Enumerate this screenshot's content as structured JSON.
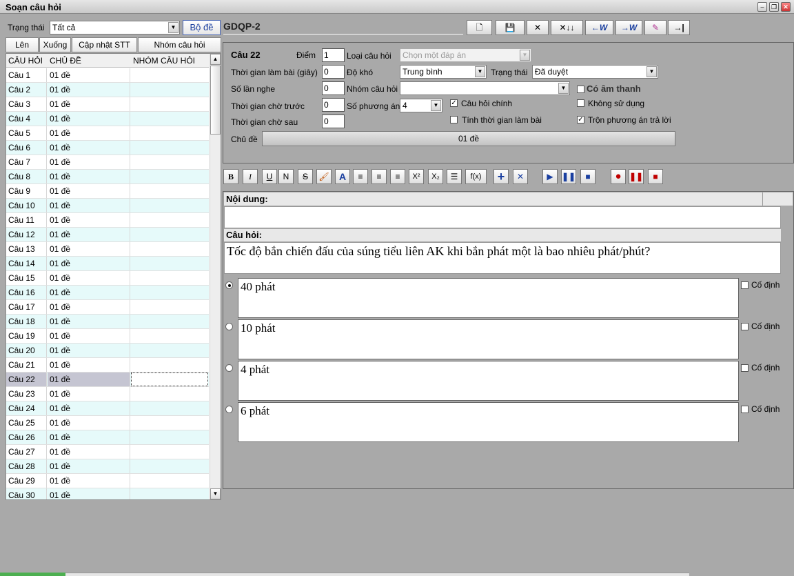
{
  "window": {
    "title": "Soạn câu hỏi"
  },
  "left": {
    "status_label": "Trạng thái",
    "status_value": "Tất cả",
    "set_button": "Bộ đề",
    "btn_up": "Lên",
    "btn_down": "Xuống",
    "btn_update": "Cập nhật STT",
    "btn_group": "Nhóm câu hỏi",
    "columns": [
      "CÂU HỎI",
      "CHỦ ĐỀ",
      "NHÓM CÂU HỎI"
    ],
    "rows": [
      {
        "q": "Câu 1",
        "topic": "01 đề"
      },
      {
        "q": "Câu 2",
        "topic": "01 đề"
      },
      {
        "q": "Câu 3",
        "topic": "01 đề"
      },
      {
        "q": "Câu 4",
        "topic": "01 đề"
      },
      {
        "q": "Câu 5",
        "topic": "01 đề"
      },
      {
        "q": "Câu 6",
        "topic": "01 đề"
      },
      {
        "q": "Câu 7",
        "topic": "01 đề"
      },
      {
        "q": "Câu 8",
        "topic": "01 đề"
      },
      {
        "q": "Câu 9",
        "topic": "01 đề"
      },
      {
        "q": "Câu 10",
        "topic": "01 đề"
      },
      {
        "q": "Câu 11",
        "topic": "01 đề"
      },
      {
        "q": "Câu 12",
        "topic": "01 đề"
      },
      {
        "q": "Câu 13",
        "topic": "01 đề"
      },
      {
        "q": "Câu 14",
        "topic": "01 đề"
      },
      {
        "q": "Câu 15",
        "topic": "01 đề"
      },
      {
        "q": "Câu 16",
        "topic": "01 đề"
      },
      {
        "q": "Câu 17",
        "topic": "01 đề"
      },
      {
        "q": "Câu 18",
        "topic": "01 đề"
      },
      {
        "q": "Câu 19",
        "topic": "01 đề"
      },
      {
        "q": "Câu 20",
        "topic": "01 đề"
      },
      {
        "q": "Câu 21",
        "topic": "01 đề"
      },
      {
        "q": "Câu 22",
        "topic": "01 đề"
      },
      {
        "q": "Câu 23",
        "topic": "01 đề"
      },
      {
        "q": "Câu 24",
        "topic": "01 đề"
      },
      {
        "q": "Câu 25",
        "topic": "01 đề"
      },
      {
        "q": "Câu 26",
        "topic": "01 đề"
      },
      {
        "q": "Câu 27",
        "topic": "01 đề"
      },
      {
        "q": "Câu 28",
        "topic": "01 đề"
      },
      {
        "q": "Câu 29",
        "topic": "01 đề"
      },
      {
        "q": "Câu 30",
        "topic": "01 đề"
      }
    ],
    "selected_row": 21
  },
  "header": {
    "code": "GDQP-2"
  },
  "props": {
    "question": "Câu 22",
    "score_label": "Điểm",
    "score": "1",
    "type_label": "Loại câu hỏi",
    "type_value": "Chọn một đáp án",
    "time_label": "Thời gian làm bài (giây)",
    "time": "0",
    "difficulty_label": "Độ khó",
    "difficulty": "Trung bình",
    "status_label": "Trạng thái",
    "status": "Đã duyệt",
    "listen_label": "Số lần nghe",
    "listen": "0",
    "group_label": "Nhóm câu hỏi",
    "group": "",
    "has_audio": "Có âm thanh",
    "wait_before_label": "Thời gian chờ trước",
    "wait_before": "0",
    "options_label": "Số phương án",
    "options": "4",
    "main_q": "Câu hỏi chính",
    "unused": "Không sử dụng",
    "wait_after_label": "Thời gian chờ sau",
    "wait_after": "0",
    "count_time": "Tính thời gian làm bài",
    "shuffle": "Trộn phương án trả lời",
    "topic_label": "Chủ đề",
    "topic": "01 đề"
  },
  "editor": {
    "content_label": "Nội dung:",
    "question_label": "Câu hỏi:",
    "question_text": "Tốc độ bắn chiến đấu của súng tiểu liên AK  khi bắn phát một là bao nhiêu phát/phút?",
    "fixed_label": "Cố định",
    "answers": [
      "40 phát",
      "10 phát",
      "4 phát",
      "6 phát"
    ],
    "correct": 0
  },
  "colors": {
    "accent_blue": "#1a3fa0",
    "record_red": "#c00000"
  }
}
